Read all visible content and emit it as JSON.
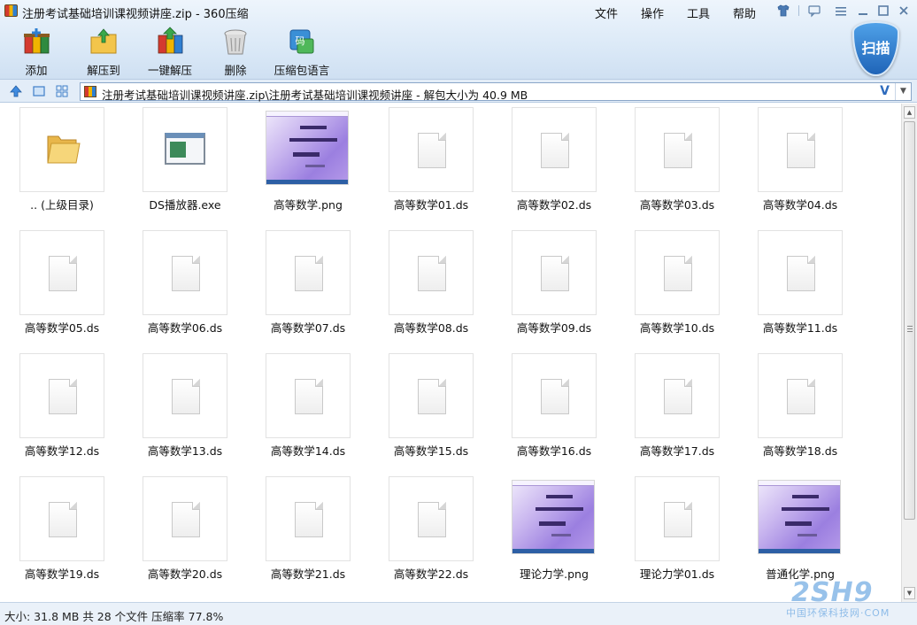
{
  "window": {
    "title": "注册考试基础培训课视频讲座.zip - 360压缩",
    "menu": [
      "文件",
      "操作",
      "工具",
      "帮助"
    ],
    "title_buttons": [
      "shirt-icon",
      "feedback-icon",
      "menu-icon",
      "minimize-icon",
      "maximize-icon",
      "close-icon"
    ]
  },
  "toolbar": {
    "items": [
      {
        "label": "添加",
        "icon": "add-archive-icon"
      },
      {
        "label": "解压到",
        "icon": "extract-to-icon"
      },
      {
        "label": "一键解压",
        "icon": "one-click-extract-icon"
      },
      {
        "label": "删除",
        "icon": "trash-icon"
      },
      {
        "label": "压缩包语言",
        "icon": "archive-language-icon"
      }
    ],
    "scan_label": "扫描",
    "language_badge": "码"
  },
  "address": {
    "path": "注册考试基础培训课视频讲座.zip\\注册考试基础培训课视频讲座 - 解包大小为 40.9 MB",
    "go_glyph": "V"
  },
  "files": [
    {
      "name": ".. (上级目录)",
      "kind": "folder"
    },
    {
      "name": "DS播放器.exe",
      "kind": "exe"
    },
    {
      "name": "高等数学.png",
      "kind": "png"
    },
    {
      "name": "高等数学01.ds",
      "kind": "doc"
    },
    {
      "name": "高等数学02.ds",
      "kind": "doc"
    },
    {
      "name": "高等数学03.ds",
      "kind": "doc"
    },
    {
      "name": "高等数学04.ds",
      "kind": "doc"
    },
    {
      "name": "高等数学05.ds",
      "kind": "doc"
    },
    {
      "name": "高等数学06.ds",
      "kind": "doc"
    },
    {
      "name": "高等数学07.ds",
      "kind": "doc"
    },
    {
      "name": "高等数学08.ds",
      "kind": "doc"
    },
    {
      "name": "高等数学09.ds",
      "kind": "doc"
    },
    {
      "name": "高等数学10.ds",
      "kind": "doc"
    },
    {
      "name": "高等数学11.ds",
      "kind": "doc"
    },
    {
      "name": "高等数学12.ds",
      "kind": "doc"
    },
    {
      "name": "高等数学13.ds",
      "kind": "doc"
    },
    {
      "name": "高等数学14.ds",
      "kind": "doc"
    },
    {
      "name": "高等数学15.ds",
      "kind": "doc"
    },
    {
      "name": "高等数学16.ds",
      "kind": "doc"
    },
    {
      "name": "高等数学17.ds",
      "kind": "doc"
    },
    {
      "name": "高等数学18.ds",
      "kind": "doc"
    },
    {
      "name": "高等数学19.ds",
      "kind": "doc"
    },
    {
      "name": "高等数学20.ds",
      "kind": "doc"
    },
    {
      "name": "高等数学21.ds",
      "kind": "doc"
    },
    {
      "name": "高等数学22.ds",
      "kind": "doc"
    },
    {
      "name": "理论力学.png",
      "kind": "png"
    },
    {
      "name": "理论力学01.ds",
      "kind": "doc"
    },
    {
      "name": "普通化学.png",
      "kind": "png"
    }
  ],
  "status": {
    "text": "大小: 31.8 MB 共 28 个文件 压缩率 77.8%"
  },
  "watermark": {
    "big": "2SH9",
    "small": "中国环保科技网·COM"
  },
  "colors": {
    "chrome": "#dbe9f7",
    "scan_button": "#1f64b8",
    "png_thumb": "#9b7fe0"
  }
}
